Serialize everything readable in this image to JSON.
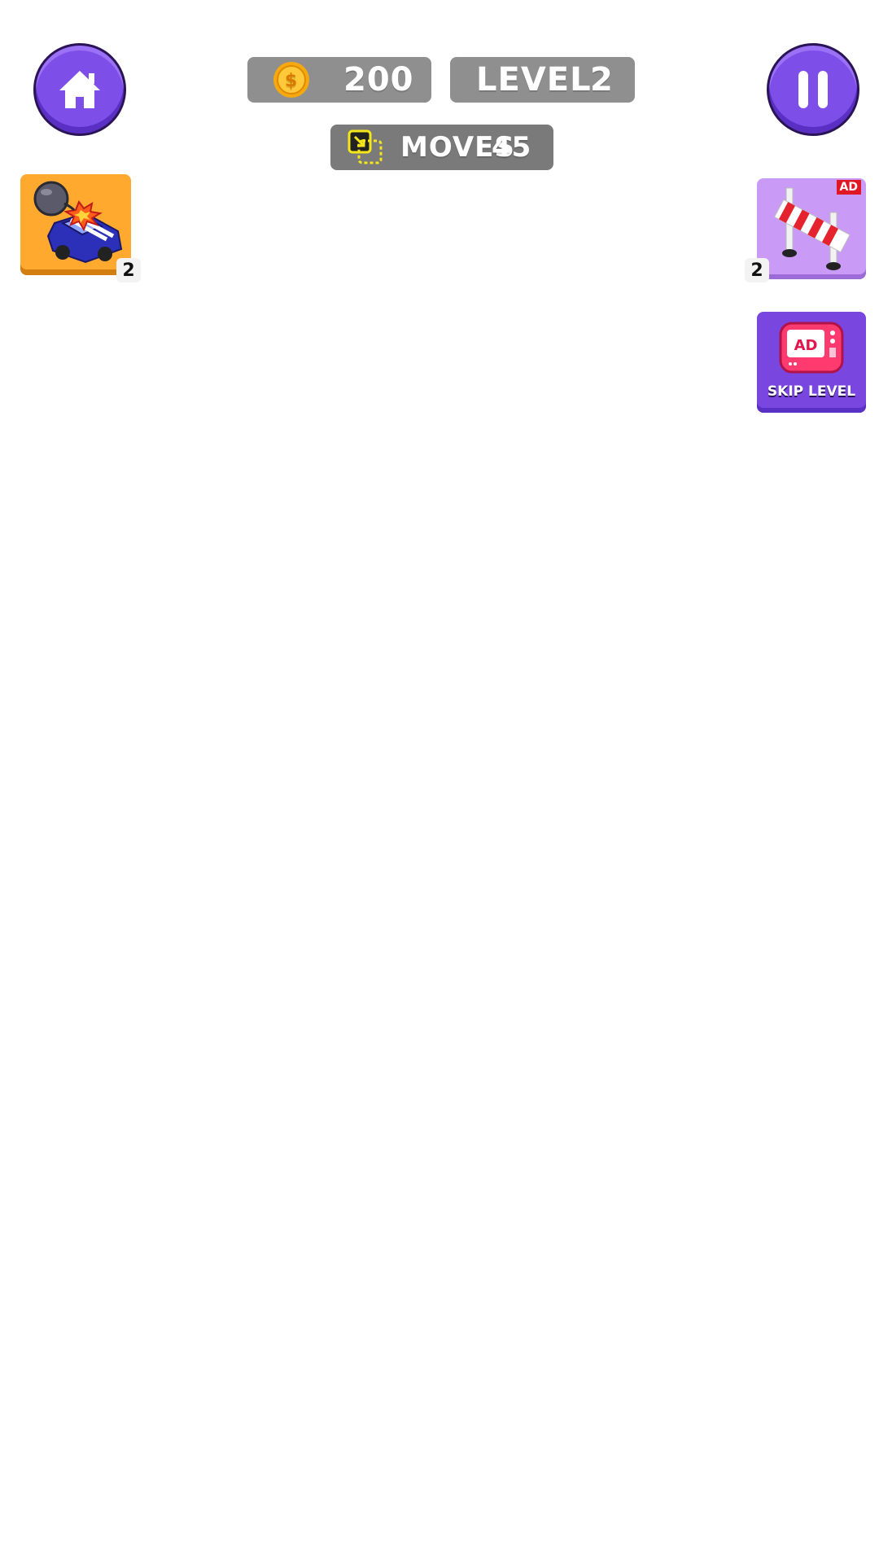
{
  "hud": {
    "coins": "200",
    "level_label": "LEVEL",
    "level_value": "2",
    "moves_label": "MOVES",
    "moves_value": "45"
  },
  "powerups": {
    "bomb": {
      "count": "2",
      "icon": "bomb-car-icon"
    },
    "barrier": {
      "count": "2",
      "ad_label": "AD",
      "icon": "barrier-icon"
    }
  },
  "skip": {
    "ad_label": "AD",
    "label": "SKIP LEVEL",
    "icon": "tv-ad-icon"
  },
  "colors": {
    "purple": "#7e4ee8",
    "pill_gray": "#8f8f8f",
    "orange": "#ffa92f",
    "lavender": "#c99af6",
    "ad_red": "#e01825"
  }
}
